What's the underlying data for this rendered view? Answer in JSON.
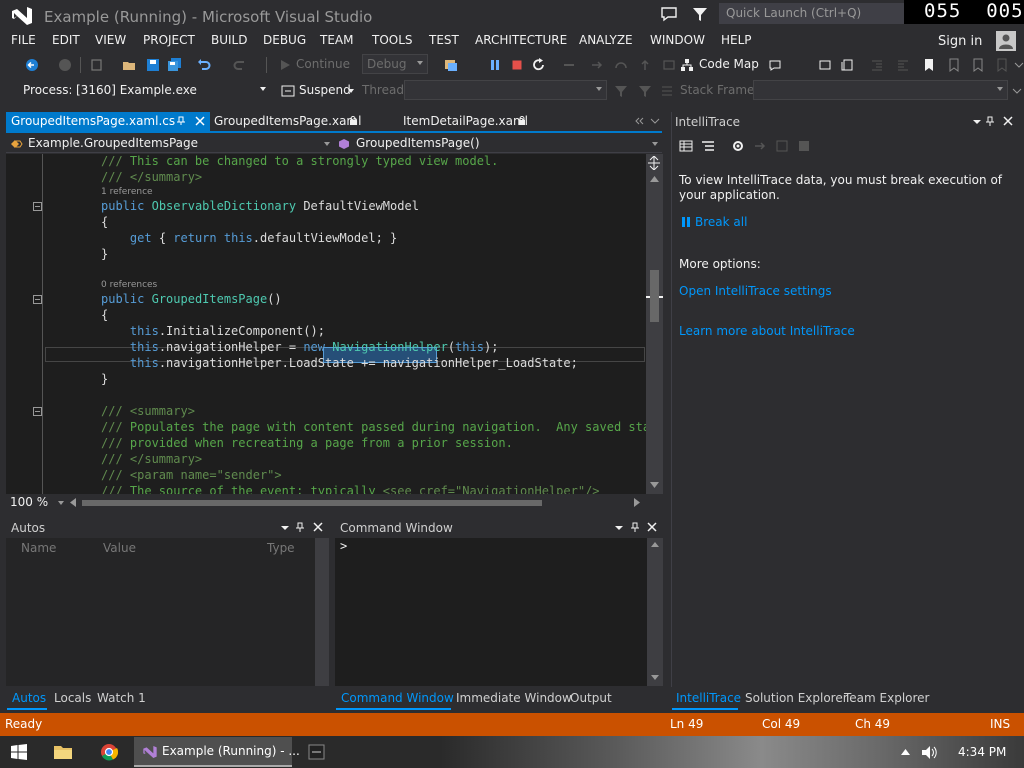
{
  "window": {
    "title": "Example (Running) - Microsoft Visual Studio",
    "quick_launch_placeholder": "Quick Launch (Ctrl+Q)",
    "framerate": "055  005"
  },
  "menu": [
    "FILE",
    "EDIT",
    "VIEW",
    "PROJECT",
    "BUILD",
    "DEBUG",
    "TEAM",
    "TOOLS",
    "TEST",
    "ARCHITECTURE",
    "ANALYZE",
    "WINDOW",
    "HELP"
  ],
  "account": {
    "sign_in": "Sign in"
  },
  "toolbar": {
    "continue": "Continue",
    "config": "Debug",
    "code_map": "Code Map",
    "process_label": "Process:",
    "process_value": "[3160] Example.exe",
    "suspend": "Suspend",
    "thread_label": "Thread:",
    "stack_frame_label": "Stack Frame:"
  },
  "tabs": [
    {
      "label": "GroupedItemsPage.xaml.cs",
      "active": true
    },
    {
      "label": "GroupedItemsPage.xaml",
      "active": false
    },
    {
      "label": "ItemDetailPage.xaml",
      "active": false
    }
  ],
  "editor": {
    "nav_class": "Example.GroupedItemsPage",
    "nav_member": "GroupedItemsPage()",
    "zoom": "100 %",
    "codelens": [
      "1 reference",
      "0 references"
    ]
  },
  "intellitrace": {
    "title": "IntelliTrace",
    "message": "To view IntelliTrace data, you must break execution of your application.",
    "break_all": "Break all",
    "more_options": "More options:",
    "open_settings": "Open IntelliTrace settings",
    "learn_more": "Learn more about IntelliTrace"
  },
  "autos": {
    "title": "Autos",
    "columns": [
      "Name",
      "Value",
      "Type"
    ]
  },
  "command_window": {
    "title": "Command Window",
    "prompt": ">"
  },
  "bottom_tabs_left": [
    "Autos",
    "Locals",
    "Watch 1"
  ],
  "bottom_tabs_mid": [
    "Command Window",
    "Immediate Window",
    "Output"
  ],
  "bottom_tabs_right": [
    "IntelliTrace",
    "Solution Explorer",
    "Team Explorer"
  ],
  "status": {
    "state": "Ready",
    "line": "Ln 49",
    "col": "Col 49",
    "ch": "Ch 49",
    "mode": "INS"
  },
  "taskbar": {
    "vs_button": "Example (Running) - ...",
    "clock": "4:34 PM"
  },
  "colors": {
    "accent": "#007acc",
    "status_bar": "#ca5100",
    "link": "#0097fb"
  }
}
